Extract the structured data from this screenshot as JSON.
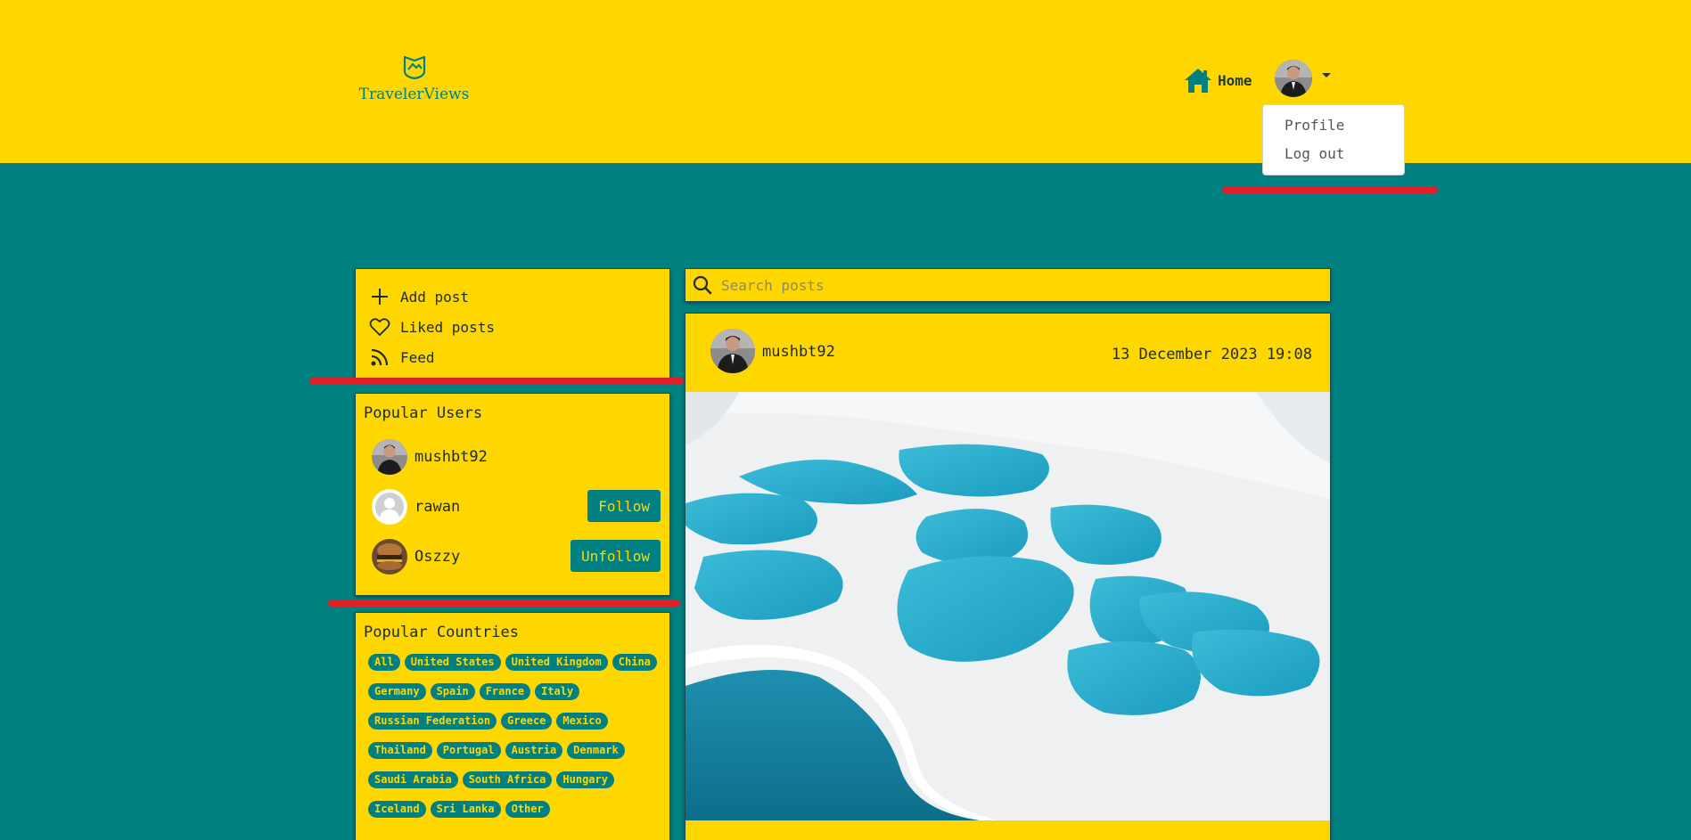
{
  "brand": {
    "name": "TravelerViews",
    "logo_icon": "mountain-shield-icon"
  },
  "nav": {
    "home_label": "Home",
    "home_icon": "house-icon",
    "dropdown": [
      "Profile",
      "Log out"
    ]
  },
  "sidebar": {
    "menu": [
      {
        "label": "Add post",
        "icon": "plus-icon"
      },
      {
        "label": "Liked posts",
        "icon": "heart-icon"
      },
      {
        "label": "Feed",
        "icon": "rss-icon"
      }
    ],
    "popular_users": {
      "title": "Popular Users",
      "users": [
        {
          "name": "mushbt92",
          "button": ""
        },
        {
          "name": "rawan",
          "button": "Follow"
        },
        {
          "name": "Oszzy",
          "button": "Unfollow"
        }
      ]
    },
    "popular_countries": {
      "title": "Popular Countries",
      "tags": [
        "All",
        "United States",
        "United Kingdom",
        "China",
        "Germany",
        "Spain",
        "France",
        "Italy",
        "Russian Federation",
        "Greece",
        "Mexico",
        "Thailand",
        "Portugal",
        "Austria",
        "Denmark",
        "Saudi Arabia",
        "South Africa",
        "Hungary",
        "Iceland",
        "Sri Lanka",
        "Other"
      ]
    }
  },
  "search": {
    "placeholder": "Search posts",
    "icon": "search-icon"
  },
  "post": {
    "username": "mushbt92",
    "date": "13 December 2023 19:08"
  },
  "colors": {
    "primary": "#ffd700",
    "accent": "#008080",
    "annotation": "#e11f26"
  }
}
